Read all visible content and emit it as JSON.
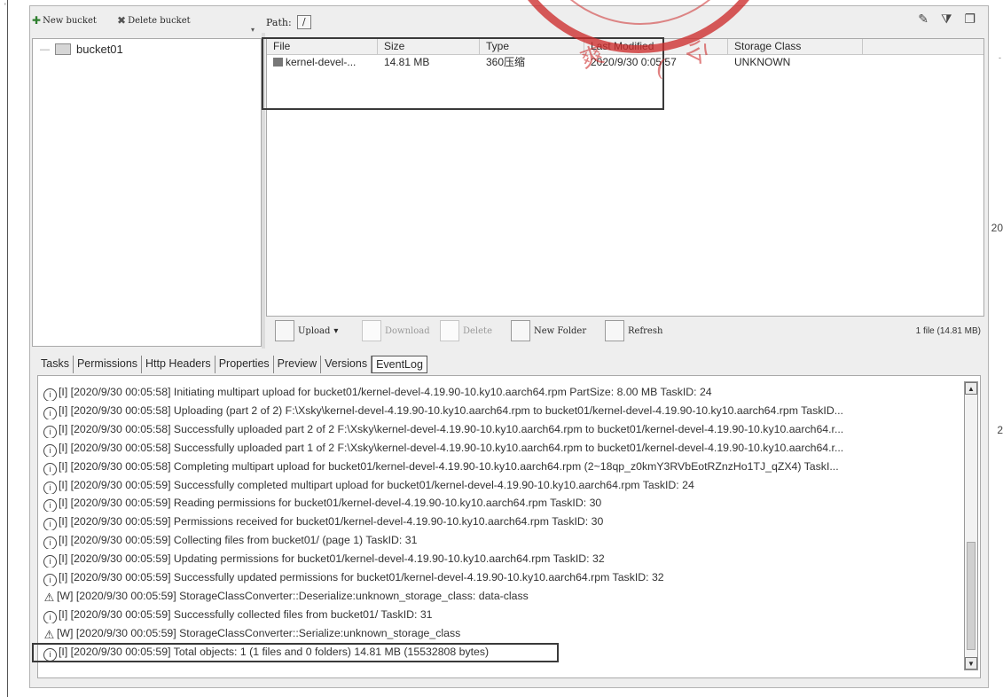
{
  "bucket_toolbar": {
    "new_bucket": "New bucket",
    "delete_bucket": "Delete bucket"
  },
  "buckets": [
    {
      "name": "bucket01"
    }
  ],
  "path": {
    "label": "Path:",
    "value": "/"
  },
  "file_table": {
    "columns": [
      "File",
      "Size",
      "Type",
      "Last Modified",
      "Storage Class"
    ],
    "rows": [
      {
        "file": "kernel-devel-...",
        "size": "14.81 MB",
        "type": "360压缩",
        "modified": "2020/9/30 0:05:57",
        "storage_class": "UNKNOWN"
      }
    ]
  },
  "actions": {
    "upload": "Upload",
    "download": "Download",
    "delete": "Delete",
    "new_folder": "New Folder",
    "refresh": "Refresh"
  },
  "file_count": "1 file (14.81 MB)",
  "tabs": [
    {
      "label": "Tasks",
      "active": false
    },
    {
      "label": "Permissions",
      "active": false
    },
    {
      "label": "Http Headers",
      "active": false
    },
    {
      "label": "Properties",
      "active": false
    },
    {
      "label": "Preview",
      "active": false
    },
    {
      "label": "Versions",
      "active": false
    },
    {
      "label": "EventLog",
      "active": true
    }
  ],
  "event_log": [
    {
      "level": "info",
      "text": "[I] [2020/9/30 00:05:58] Initiating multipart upload for bucket01/kernel-devel-4.19.90-10.ky10.aarch64.rpm PartSize: 8.00 MB TaskID: 24"
    },
    {
      "level": "info",
      "text": "[I] [2020/9/30 00:05:58] Uploading (part 2 of 2) F:\\Xsky\\kernel-devel-4.19.90-10.ky10.aarch64.rpm to bucket01/kernel-devel-4.19.90-10.ky10.aarch64.rpm TaskID..."
    },
    {
      "level": "info",
      "text": "[I] [2020/9/30 00:05:58] Successfully uploaded part 2 of 2 F:\\Xsky\\kernel-devel-4.19.90-10.ky10.aarch64.rpm to bucket01/kernel-devel-4.19.90-10.ky10.aarch64.r..."
    },
    {
      "level": "info",
      "text": "[I] [2020/9/30 00:05:58] Successfully uploaded part 1 of 2 F:\\Xsky\\kernel-devel-4.19.90-10.ky10.aarch64.rpm to bucket01/kernel-devel-4.19.90-10.ky10.aarch64.r..."
    },
    {
      "level": "info",
      "text": "[I] [2020/9/30 00:05:58] Completing multipart upload for bucket01/kernel-devel-4.19.90-10.ky10.aarch64.rpm (2~18qp_z0kmY3RVbEotRZnzHo1TJ_qZX4) TaskI..."
    },
    {
      "level": "info",
      "text": "[I] [2020/9/30 00:05:59] Successfully completed multipart upload for bucket01/kernel-devel-4.19.90-10.ky10.aarch64.rpm TaskID: 24"
    },
    {
      "level": "info",
      "text": "[I] [2020/9/30 00:05:59] Reading permissions for bucket01/kernel-devel-4.19.90-10.ky10.aarch64.rpm TaskID: 30"
    },
    {
      "level": "info",
      "text": "[I] [2020/9/30 00:05:59] Permissions received for bucket01/kernel-devel-4.19.90-10.ky10.aarch64.rpm TaskID: 30"
    },
    {
      "level": "info",
      "text": "[I] [2020/9/30 00:05:59] Collecting files from bucket01/ (page 1) TaskID: 31"
    },
    {
      "level": "info",
      "text": "[I] [2020/9/30 00:05:59] Updating permissions for bucket01/kernel-devel-4.19.90-10.ky10.aarch64.rpm TaskID: 32"
    },
    {
      "level": "info",
      "text": "[I] [2020/9/30 00:05:59] Successfully updated permissions for bucket01/kernel-devel-4.19.90-10.ky10.aarch64.rpm TaskID: 32"
    },
    {
      "level": "warn",
      "text": "[W] [2020/9/30 00:05:59] StorageClassConverter::Deserialize:unknown_storage_class: data-class"
    },
    {
      "level": "info",
      "text": "[I] [2020/9/30 00:05:59] Successfully collected files from bucket01/ TaskID: 31"
    },
    {
      "level": "warn",
      "text": "[W] [2020/9/30 00:05:59] StorageClassConverter::Serialize:unknown_storage_class"
    },
    {
      "level": "info",
      "text": "[I] [2020/9/30 00:05:59] Total objects: 1 (1 files and 0 folders) 14.81 MB (15532808 bytes)"
    }
  ],
  "margin_marks": [
    "20",
    "2"
  ],
  "colors": {
    "stamp": "#cd2d2d",
    "highlight_box": "#3a3a3a",
    "selected_tab": "#fafafa"
  }
}
